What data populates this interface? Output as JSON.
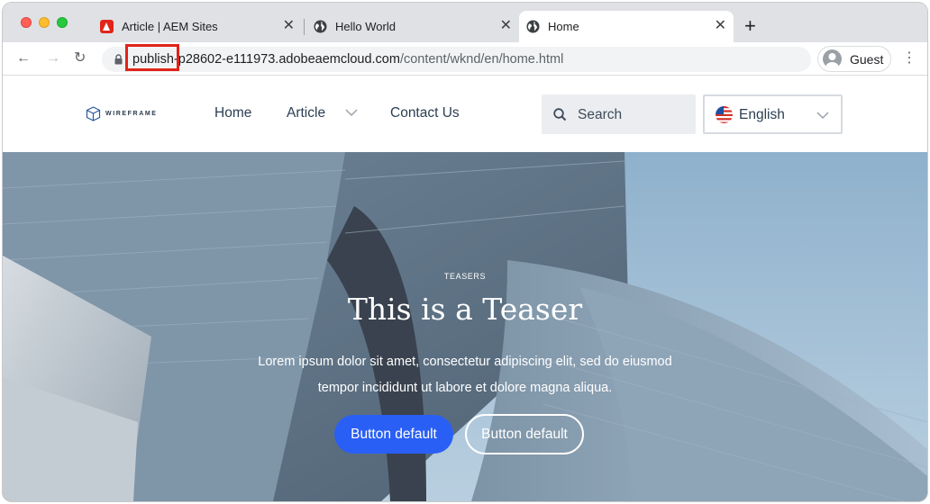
{
  "browser": {
    "tabs": [
      {
        "title": "Article | AEM Sites",
        "icon": "adobe-icon"
      },
      {
        "title": "Hello World",
        "icon": "globe-icon"
      },
      {
        "title": "Home",
        "icon": "globe-icon",
        "active": true
      }
    ],
    "tab_close_glyph": "✕",
    "new_tab_glyph": "+",
    "nav": {
      "back_glyph": "←",
      "forward_glyph": "→",
      "reload_glyph": "↻",
      "menu_glyph": "⋮"
    },
    "url": {
      "host": "publish-p28602-e111973.adobeaemcloud.com",
      "path": "/content/wknd/en/home.html"
    },
    "profile_label": "Guest"
  },
  "site": {
    "logo_text": "WIREFRAME",
    "nav": [
      {
        "label": "Home"
      },
      {
        "label": "Article",
        "has_submenu": true
      },
      {
        "label": "Contact Us"
      }
    ],
    "search_placeholder": "Search",
    "language": "English"
  },
  "teaser": {
    "pretitle": "TEASERS",
    "title": "This is a Teaser",
    "description": "Lorem ipsum dolor sit amet, consectetur adipiscing elit, sed do eiusmod tempor incididunt ut labore et dolore magna aliqua.",
    "primary_button": "Button default",
    "secondary_button": "Button default"
  },
  "colors": {
    "annotation": "#e2231a",
    "primary_button": "#2a5ff5"
  }
}
